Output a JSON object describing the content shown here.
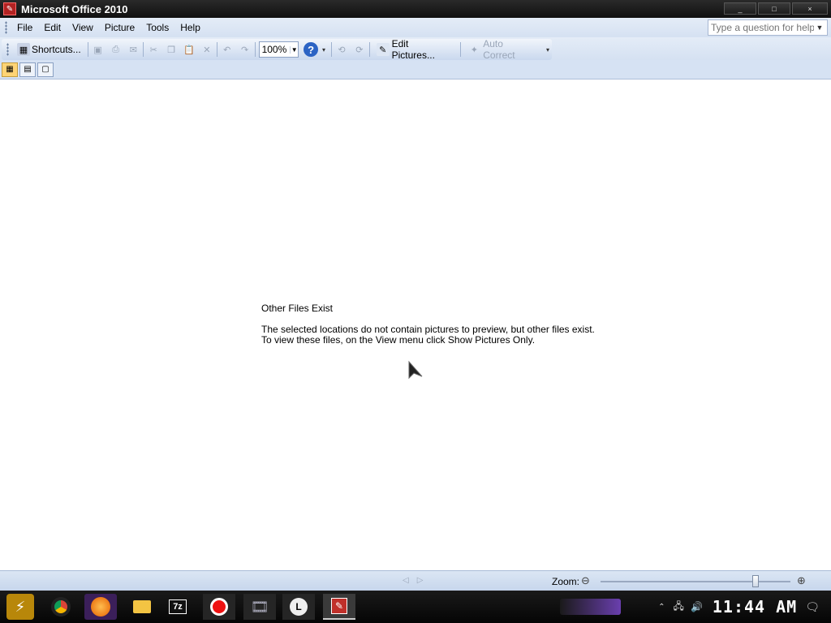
{
  "window": {
    "title": "Microsoft Office 2010",
    "controls": {
      "minimize": "_",
      "maximize": "□",
      "close": "×"
    }
  },
  "menu": {
    "items": [
      {
        "label": "File"
      },
      {
        "label": "Edit"
      },
      {
        "label": "View"
      },
      {
        "label": "Picture"
      },
      {
        "label": "Tools"
      },
      {
        "label": "Help"
      }
    ],
    "help_placeholder": "Type a question for help"
  },
  "toolbar": {
    "shortcuts_label": "Shortcuts...",
    "zoom_value": "100%",
    "edit_pictures_label": "Edit Pictures...",
    "auto_correct_label": "Auto Correct"
  },
  "content": {
    "heading": "Other Files Exist",
    "line1": "The selected locations do not contain pictures to preview, but other files exist.",
    "line2": "To view these files, on the View menu click Show Pictures Only."
  },
  "statusbar": {
    "zoom_label": "Zoom:",
    "zoom_level": 0.82
  },
  "taskbar": {
    "clock": "11:44 AM"
  },
  "icons": {
    "app": "office-picture-manager-icon",
    "help": "help-icon",
    "shortcuts": "shortcuts-icon"
  }
}
